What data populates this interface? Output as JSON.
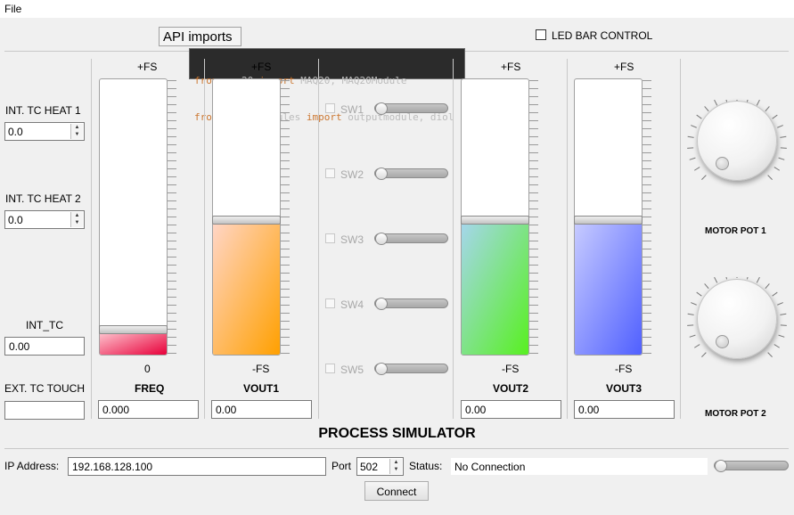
{
  "menu": {
    "file": "File"
  },
  "api_imports_label": "API imports",
  "code_lines": [
    {
      "kw1": "from",
      "mod": " maq20 ",
      "kw2": "import",
      "rest": " MAQ20, MAQ20Module"
    },
    {
      "kw1": "from",
      "mod": " maq20.modules ",
      "kw2": "import",
      "rest": " outputmodule, diol"
    }
  ],
  "led_bar_control": "LED BAR CONTROL",
  "left_panel": {
    "heat1_label": "INT. TC HEAT 1",
    "heat1_value": "0.0",
    "heat2_label": "INT. TC HEAT 2",
    "heat2_value": "0.0",
    "int_tc_label": "INT_TC",
    "int_tc_value": "0.00",
    "ext_tc_label": "EXT. TC TOUCH",
    "ext_tc_value": ""
  },
  "tanks": [
    {
      "top": "+FS",
      "bottom": "0",
      "name": "FREQ",
      "value": "0.000",
      "level": 0.09,
      "fill_from": "#ffd0d8",
      "fill_to": "#e8003a"
    },
    {
      "top": "+FS",
      "bottom": "-FS",
      "name": "VOUT1",
      "value": "0.00",
      "level": 0.49,
      "fill_from": "#ffd6c8",
      "fill_to": "#ffa000"
    },
    {
      "top": "+FS",
      "bottom": "-FS",
      "name": "VOUT2",
      "value": "0.00",
      "level": 0.49,
      "fill_from": "#a6d6ee",
      "fill_to": "#58f020"
    },
    {
      "top": "+FS",
      "bottom": "-FS",
      "name": "VOUT3",
      "value": "0.00",
      "level": 0.49,
      "fill_from": "#c8ccff",
      "fill_to": "#5060ff"
    }
  ],
  "switches": [
    {
      "label": "SW1",
      "value": 0
    },
    {
      "label": "SW2",
      "value": 0
    },
    {
      "label": "SW3",
      "value": 0
    },
    {
      "label": "SW4",
      "value": 0
    },
    {
      "label": "SW5",
      "value": 0
    }
  ],
  "motor_pots": [
    {
      "label": "MOTOR POT 1"
    },
    {
      "label": "MOTOR POT 2"
    }
  ],
  "title": "PROCESS SIMULATOR",
  "connection": {
    "ip_label": "IP Address:",
    "ip_value": "192.168.128.100",
    "port_label": "Port",
    "port_value": "502",
    "status_label": "Status:",
    "status_value": "No Connection",
    "connect_label": "Connect",
    "slider_value": 0
  }
}
